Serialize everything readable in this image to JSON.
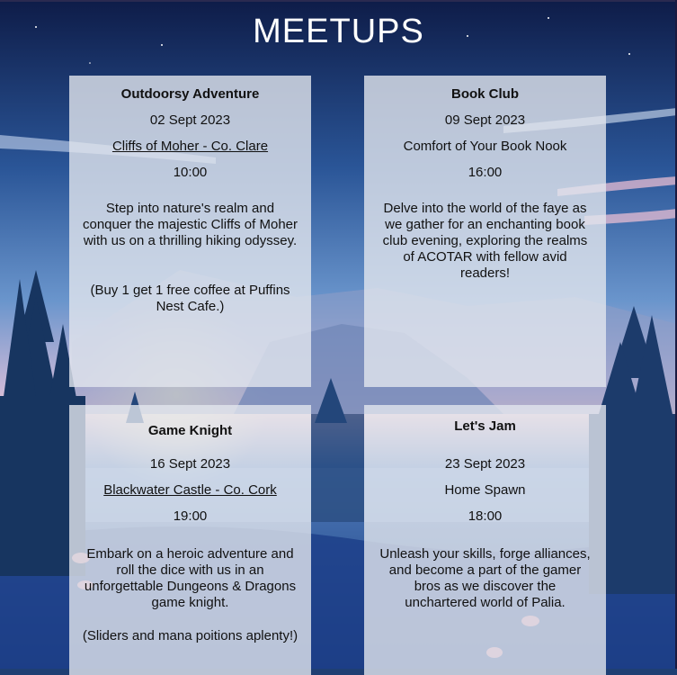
{
  "page": {
    "title": "MEETUPS"
  },
  "colors": {
    "card_bg": "#e2e6ee",
    "sky_top": "#0e1c48",
    "sky_mid": "#3a6db0",
    "glow": "#f6b7c4"
  },
  "meetups": [
    {
      "title": "Outdoorsy Adventure",
      "date": "02 Sept 2023",
      "location": "Cliffs of Moher - Co. Clare",
      "location_is_link": true,
      "time": "10:00",
      "description": "Step into nature's realm and conquer the majestic Cliffs of Moher with us on a thrilling hiking odyssey.",
      "note": "(Buy 1 get 1 free coffee at Puffins Nest Cafe.)"
    },
    {
      "title": "Book Club",
      "date": "09 Sept 2023",
      "location": "Comfort of Your Book Nook",
      "location_is_link": false,
      "time": "16:00",
      "description": "Delve into the world of the faye as we gather for an enchanting book club evening, exploring the realms of ACOTAR with fellow avid readers!",
      "note": ""
    },
    {
      "title": "Game Knight",
      "date": "16 Sept 2023",
      "location": "Blackwater Castle - Co. Cork",
      "location_is_link": true,
      "time": "19:00",
      "description": "Embark on a heroic adventure and roll the dice with us in an unforgettable Dungeons & Dragons game knight.",
      "note": "(Sliders and mana poitions aplenty!)"
    },
    {
      "title": "Let's Jam",
      "date": "23 Sept 2023",
      "location": "Home Spawn",
      "location_is_link": false,
      "time": "18:00",
      "description": "Unleash your skills, forge alliances, and become a part of the gamer bros as we discover the unchartered world of Palia.",
      "note": ""
    }
  ]
}
